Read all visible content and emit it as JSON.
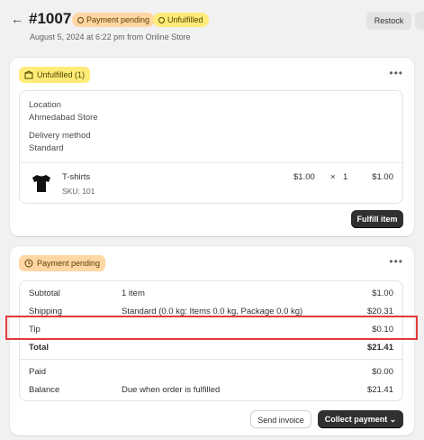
{
  "header": {
    "back_icon": "arrow-left-icon",
    "order_number": "#1007",
    "payment_badge": "Payment pending",
    "fulfillment_badge": "Unfulfilled",
    "subline": "August 5, 2024 at 6:22 pm from Online Store",
    "restock_label": "Restock"
  },
  "fulfillment_card": {
    "badge": "Unfulfilled (1)",
    "location_label": "Location",
    "location_value": "Ahmedabad Store",
    "delivery_label": "Delivery method",
    "delivery_value": "Standard",
    "item": {
      "name": "T-shirts",
      "sku": "SKU: 101",
      "price": "$1.00",
      "times": "×",
      "qty": "1",
      "total": "$1.00"
    },
    "fulfill_button": "Fulfill item"
  },
  "payment_card": {
    "badge": "Payment pending",
    "rows": [
      {
        "label": "Subtotal",
        "middle": "1 item",
        "value": "$1.00"
      },
      {
        "label": "Shipping",
        "middle": "Standard (0.0 kg: Items 0.0 kg, Package 0.0 kg)",
        "value": "$20.31"
      },
      {
        "label": "Tip",
        "middle": "",
        "value": "$0.10"
      },
      {
        "label": "Total",
        "middle": "",
        "value": "$21.41"
      }
    ],
    "rows2": [
      {
        "label": "Paid",
        "middle": "",
        "value": "$0.00"
      },
      {
        "label": "Balance",
        "middle": "Due when order is fulfilled",
        "value": "$21.41"
      }
    ],
    "send_invoice": "Send invoice",
    "collect_payment": "Collect payment"
  },
  "colors": {
    "highlight": "#e23a3a",
    "pending_badge": "#ffd6a4",
    "unfulfilled_badge": "#ffeb78",
    "primary_button": "#303030"
  }
}
